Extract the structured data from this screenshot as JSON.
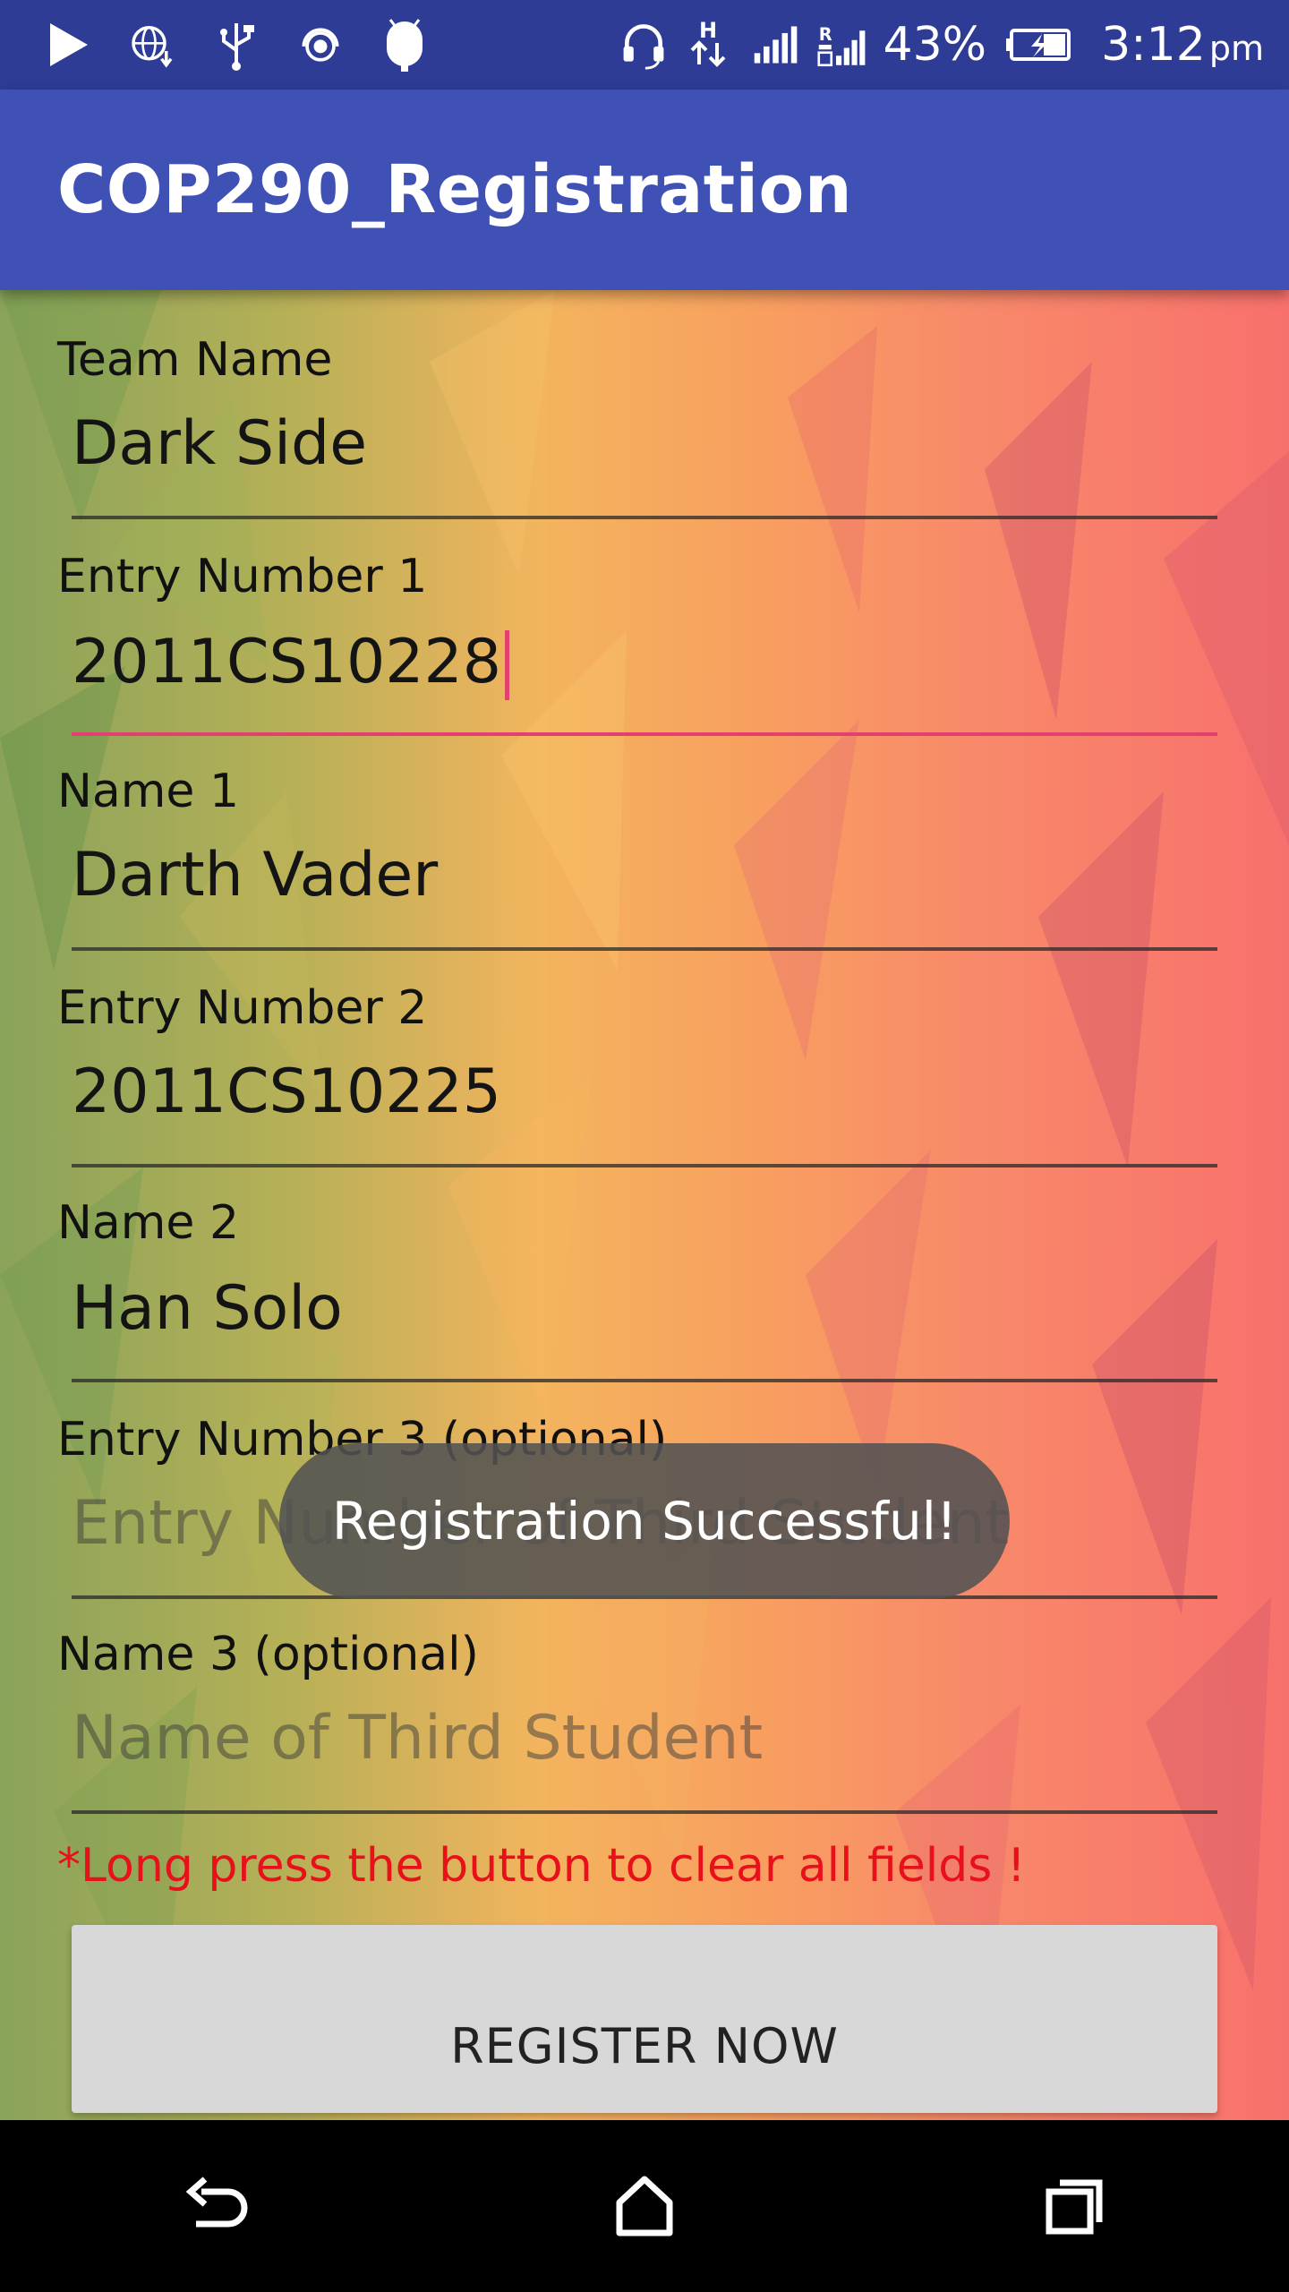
{
  "status_bar": {
    "icons": [
      "play-icon",
      "web-download-icon",
      "usb-icon",
      "hotspot-icon",
      "android-debug-icon",
      "headset-icon",
      "h-data-icon",
      "signal-icon",
      "roaming-signal-icon",
      "battery-charging-icon"
    ],
    "battery_percent": "43%",
    "time": "3:12",
    "time_suffix": "pm"
  },
  "app_bar": {
    "title": "COP290_Registration"
  },
  "form": {
    "team_name": {
      "label": "Team Name",
      "value": "Dark Side"
    },
    "entry1": {
      "label": "Entry Number 1",
      "value": "2011CS10228"
    },
    "name1": {
      "label": "Name 1",
      "value": "Darth Vader"
    },
    "entry2": {
      "label": "Entry Number 2",
      "value": "2011CS10225"
    },
    "name2": {
      "label": "Name 2",
      "value": "Han Solo"
    },
    "entry3": {
      "label": "Entry Number 3 (optional)",
      "placeholder": "Entry Number of Third Student"
    },
    "name3": {
      "label": "Name 3 (optional)",
      "placeholder": "Name of Third Student"
    },
    "hint": "*Long press the button to clear all fields !",
    "register_label": "REGISTER NOW"
  },
  "toast": {
    "message": "Registration Successful!"
  },
  "nav_bar": {
    "icons": [
      "back-icon",
      "home-icon",
      "recents-icon"
    ]
  },
  "colors": {
    "status_bar": "#2e3c96",
    "app_bar": "#3f51b5",
    "focus_accent": "#e2406e",
    "hint_text": "#e8101a"
  }
}
